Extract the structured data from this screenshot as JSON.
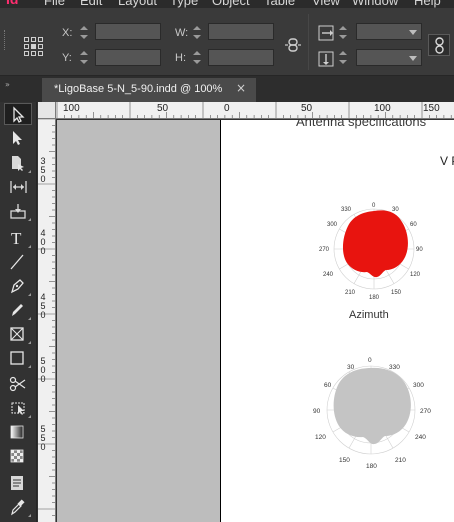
{
  "app": {
    "logo_text": "Id",
    "menus": [
      "File",
      "Edit",
      "Layout",
      "Type",
      "Object",
      "Table",
      "View",
      "Window",
      "Help"
    ]
  },
  "control_panel": {
    "x_label": "X:",
    "y_label": "Y:",
    "w_label": "W:",
    "h_label": "H:",
    "x_value": "",
    "y_value": "",
    "w_value": "",
    "h_value": ""
  },
  "tabs": {
    "document_title": "*LigoBase 5-N_5-90.indd @ 100%",
    "close_symbol": "×",
    "collapse_symbol": "»"
  },
  "tools": [
    {
      "name": "selection-tool",
      "icon": "arrow-black"
    },
    {
      "name": "direct-selection-tool",
      "icon": "arrow-white"
    },
    {
      "name": "page-tool",
      "icon": "page"
    },
    {
      "name": "gap-tool",
      "icon": "gap"
    },
    {
      "name": "content-collector-tool",
      "icon": "collector"
    },
    {
      "name": "type-tool",
      "icon": "T"
    },
    {
      "name": "line-tool",
      "icon": "line"
    },
    {
      "name": "pen-tool",
      "icon": "pen"
    },
    {
      "name": "pencil-tool",
      "icon": "pencil"
    },
    {
      "name": "rectangle-frame-tool",
      "icon": "frame-x"
    },
    {
      "name": "rectangle-tool",
      "icon": "rectangle"
    },
    {
      "name": "scissors-tool",
      "icon": "scissors"
    },
    {
      "name": "free-transform-tool",
      "icon": "transform"
    },
    {
      "name": "gradient-swatch-tool",
      "icon": "gradient"
    },
    {
      "name": "gradient-feather-tool",
      "icon": "feather"
    },
    {
      "name": "note-tool",
      "icon": "note"
    },
    {
      "name": "eyedropper-tool",
      "icon": "eyedropper"
    }
  ],
  "ruler": {
    "top_labels": [
      "100",
      "50",
      "0",
      "50",
      "100",
      "150"
    ],
    "left_labels": [
      [
        "3",
        "5",
        "0"
      ],
      [
        "4",
        "0",
        "0"
      ],
      [
        "4",
        "5",
        "0"
      ],
      [
        "5",
        "0",
        "0"
      ],
      [
        "5",
        "5",
        "0"
      ]
    ]
  },
  "page": {
    "heading": "Antenna specifications",
    "vp_label": "V P",
    "azimuth_label": "Azimuth",
    "red_plot_labels": [
      "0",
      "30",
      "60",
      "90",
      "120",
      "150",
      "180",
      "210",
      "240",
      "270",
      "300",
      "330"
    ],
    "grey_plot_labels": [
      "0",
      "30",
      "60",
      "90",
      "120",
      "150",
      "180",
      "210",
      "240",
      "270",
      "300",
      "330"
    ]
  },
  "colors": {
    "accent_logo": "#ff2d6f",
    "pattern_red": "#e8140f",
    "pattern_grey": "#c4c4c4"
  }
}
